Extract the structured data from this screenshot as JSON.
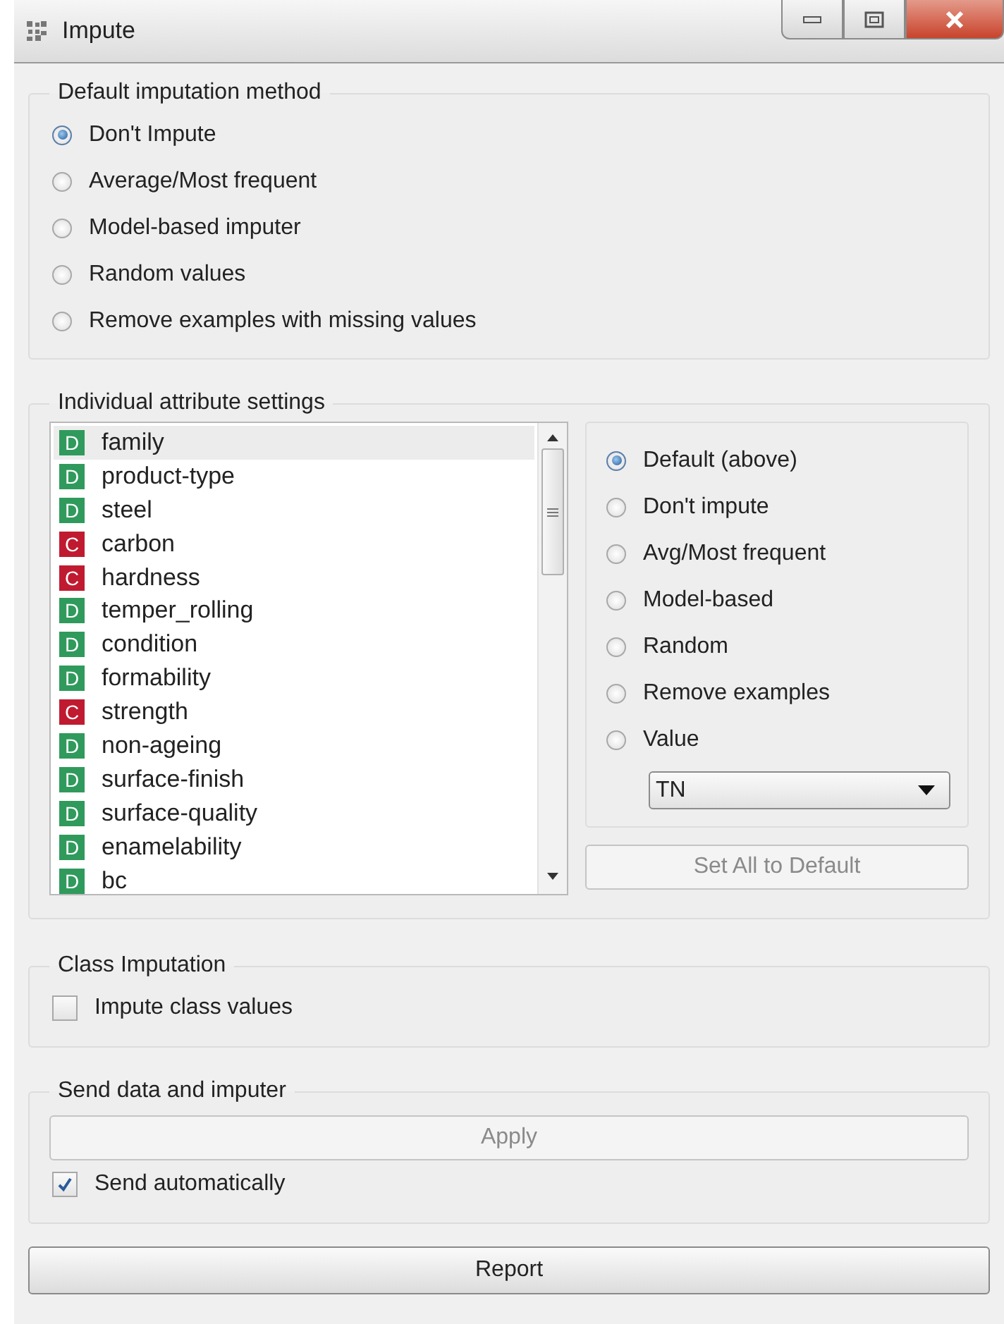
{
  "window": {
    "title": "Impute"
  },
  "default_method": {
    "title": "Default imputation method",
    "options": [
      {
        "label": "Don't Impute",
        "selected": true
      },
      {
        "label": "Average/Most frequent",
        "selected": false
      },
      {
        "label": "Model-based imputer",
        "selected": false
      },
      {
        "label": "Random values",
        "selected": false
      },
      {
        "label": "Remove examples with missing values",
        "selected": false
      }
    ]
  },
  "individual": {
    "title": "Individual attribute settings",
    "attributes": [
      {
        "badge": "D",
        "color": "#2f9a5c",
        "name": "family",
        "selected": true
      },
      {
        "badge": "D",
        "color": "#2f9a5c",
        "name": "product-type",
        "selected": false
      },
      {
        "badge": "D",
        "color": "#2f9a5c",
        "name": "steel",
        "selected": false
      },
      {
        "badge": "C",
        "color": "#c01a30",
        "name": "carbon",
        "selected": false
      },
      {
        "badge": "C",
        "color": "#c01a30",
        "name": "hardness",
        "selected": false
      },
      {
        "badge": "D",
        "color": "#2f9a5c",
        "name": "temper_rolling",
        "selected": false
      },
      {
        "badge": "D",
        "color": "#2f9a5c",
        "name": "condition",
        "selected": false
      },
      {
        "badge": "D",
        "color": "#2f9a5c",
        "name": "formability",
        "selected": false
      },
      {
        "badge": "C",
        "color": "#c01a30",
        "name": "strength",
        "selected": false
      },
      {
        "badge": "D",
        "color": "#2f9a5c",
        "name": "non-ageing",
        "selected": false
      },
      {
        "badge": "D",
        "color": "#2f9a5c",
        "name": "surface-finish",
        "selected": false
      },
      {
        "badge": "D",
        "color": "#2f9a5c",
        "name": "surface-quality",
        "selected": false
      },
      {
        "badge": "D",
        "color": "#2f9a5c",
        "name": "enamelability",
        "selected": false
      },
      {
        "badge": "D",
        "color": "#2f9a5c",
        "name": "bc",
        "selected": false
      }
    ],
    "options": [
      {
        "label": "Default (above)",
        "selected": true
      },
      {
        "label": "Don't impute",
        "selected": false
      },
      {
        "label": "Avg/Most frequent",
        "selected": false
      },
      {
        "label": "Model-based",
        "selected": false
      },
      {
        "label": "Random",
        "selected": false
      },
      {
        "label": "Remove examples",
        "selected": false
      },
      {
        "label": "Value",
        "selected": false
      }
    ],
    "value_dropdown": {
      "value": "TN"
    },
    "set_all_button": {
      "label": "Set All to Default",
      "disabled": true
    }
  },
  "class_imputation": {
    "title": "Class Imputation",
    "checkbox": {
      "label": "Impute class values",
      "checked": false
    }
  },
  "send": {
    "title": "Send data and imputer",
    "apply_button": {
      "label": "Apply",
      "disabled": true
    },
    "checkbox": {
      "label": "Send automatically",
      "checked": true
    }
  },
  "report_button": {
    "label": "Report"
  }
}
